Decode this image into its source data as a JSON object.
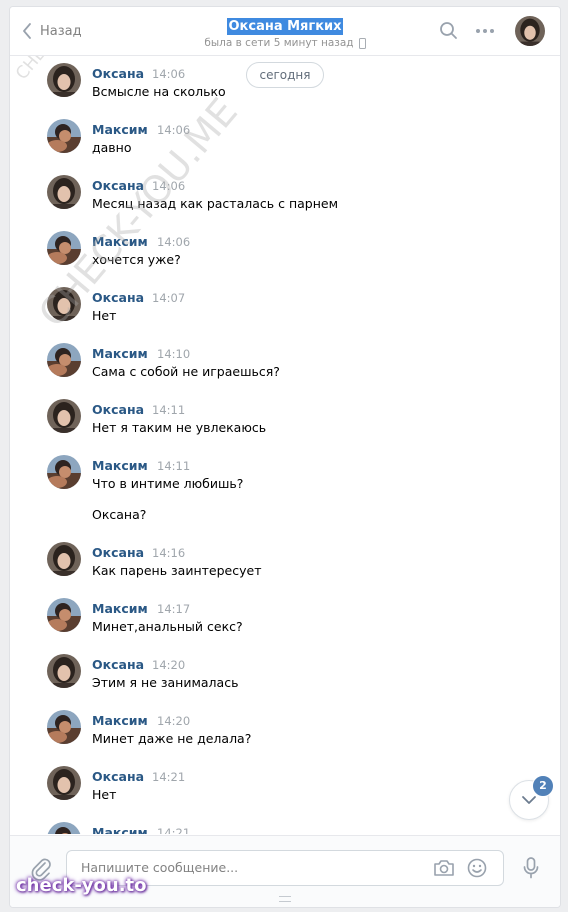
{
  "header": {
    "back_label": "Назад",
    "title": "Оксана Мягких",
    "status": "была в сети 5 минут назад"
  },
  "date_separator": "сегодня",
  "messages": [
    {
      "author": "Оксана",
      "side": "oksana",
      "time": "14:06",
      "lines": [
        "Всмысле на сколько"
      ]
    },
    {
      "author": "Максим",
      "side": "maxim",
      "time": "14:06",
      "lines": [
        "давно"
      ]
    },
    {
      "author": "Оксана",
      "side": "oksana",
      "time": "14:06",
      "lines": [
        "Месяц назад как расталась с парнем"
      ]
    },
    {
      "author": "Максим",
      "side": "maxim",
      "time": "14:06",
      "lines": [
        "хочется уже?"
      ]
    },
    {
      "author": "Оксана",
      "side": "oksana",
      "time": "14:07",
      "lines": [
        "Нет"
      ]
    },
    {
      "author": "Максим",
      "side": "maxim",
      "time": "14:10",
      "lines": [
        "Сама с собой не играешься?"
      ]
    },
    {
      "author": "Оксана",
      "side": "oksana",
      "time": "14:11",
      "lines": [
        "Нет я таким не увлекаюсь"
      ]
    },
    {
      "author": "Максим",
      "side": "maxim",
      "time": "14:11",
      "lines": [
        "Что в интиме любишь?",
        "Оксана?"
      ]
    },
    {
      "author": "Оксана",
      "side": "oksana",
      "time": "14:16",
      "lines": [
        "Как парень заинтересует"
      ]
    },
    {
      "author": "Максим",
      "side": "maxim",
      "time": "14:17",
      "lines": [
        "Минет,анальный секс?"
      ]
    },
    {
      "author": "Оксана",
      "side": "oksana",
      "time": "14:20",
      "lines": [
        "Этим я не занималась"
      ]
    },
    {
      "author": "Максим",
      "side": "maxim",
      "time": "14:20",
      "lines": [
        "Минет даже не делала?"
      ]
    },
    {
      "author": "Оксана",
      "side": "oksana",
      "time": "14:21",
      "lines": [
        "Нет"
      ]
    },
    {
      "author": "Максим",
      "side": "maxim",
      "time": "14:21",
      "lines": []
    }
  ],
  "unread_count": "2",
  "composer": {
    "placeholder": "Напишите сообщение..."
  },
  "watermarks": {
    "diagonal_small": "CHECK-YOU.ME",
    "diagonal_large": "CHECK-YOU.ME",
    "bottom": "check-you.to"
  },
  "colors": {
    "accent": "#5181b8",
    "name_link": "#2a5885",
    "title_highlight": "#3f8ae0"
  }
}
